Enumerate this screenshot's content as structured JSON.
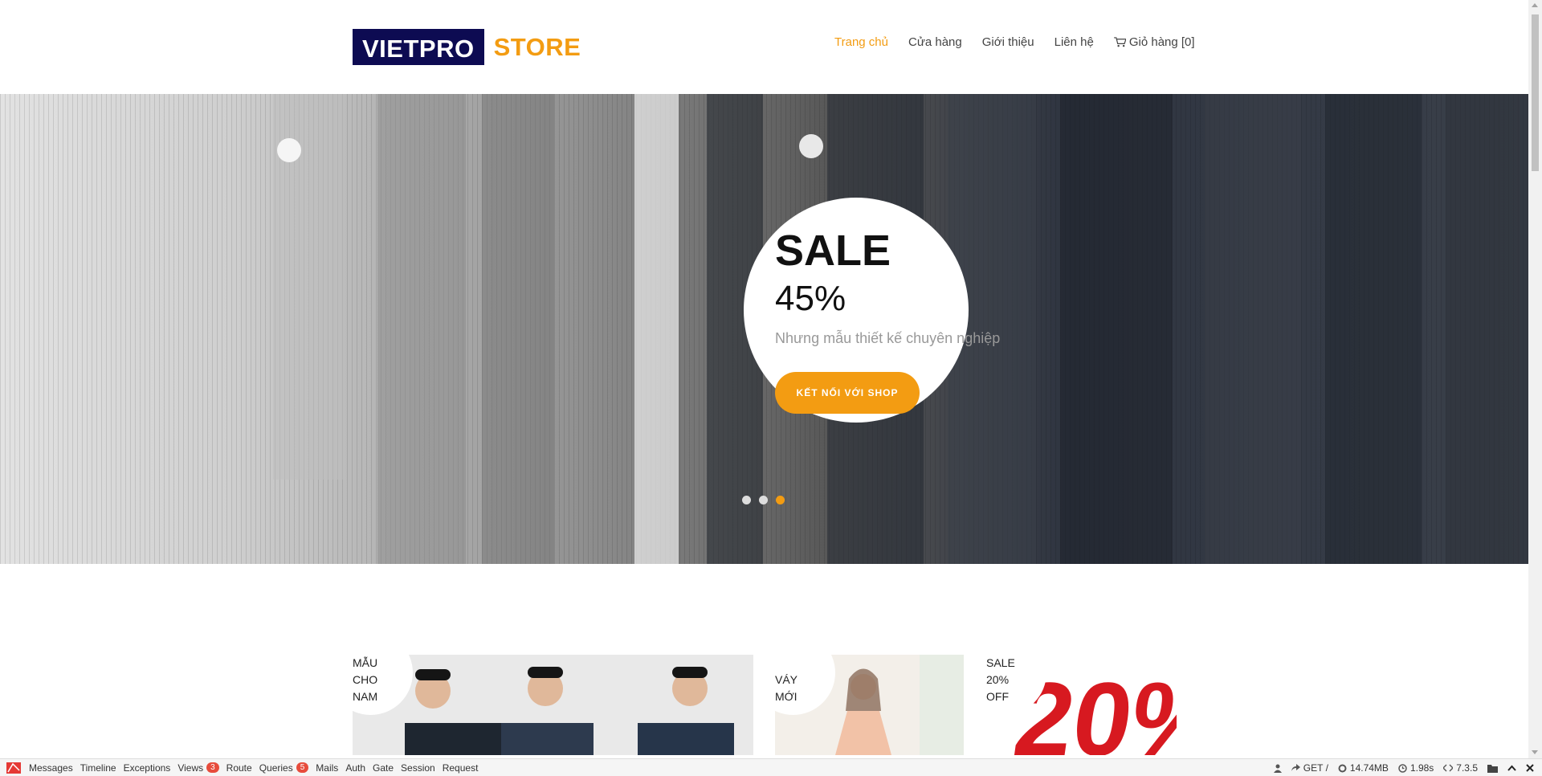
{
  "logo": {
    "part1": "VIETPRO",
    "part2": "STORE"
  },
  "nav": {
    "items": [
      {
        "label": "Trang chủ",
        "active": true
      },
      {
        "label": "Cửa hàng"
      },
      {
        "label": "Giới thiệu"
      },
      {
        "label": "Liên hệ"
      }
    ],
    "cart_label": "Giỏ hàng [0]"
  },
  "hero": {
    "title": "SALE",
    "percent": "45%",
    "subtitle": "Nhưng mẫu thiết kế chuyên nghiệp",
    "button": "KẾT NỐI VỚI SHOP",
    "active_slide": 3,
    "slide_count": 3
  },
  "categories": [
    {
      "label": "MẪU\nCHO\nNAM"
    },
    {
      "label": "VÁY\nMỚI"
    },
    {
      "label": "SALE\n20%\nOFF"
    }
  ],
  "sale_banner_text": "20%",
  "debugbar": {
    "tabs": [
      {
        "label": "Messages"
      },
      {
        "label": "Timeline"
      },
      {
        "label": "Exceptions"
      },
      {
        "label": "Views",
        "badge": "3"
      },
      {
        "label": "Route"
      },
      {
        "label": "Queries",
        "badge": "5"
      },
      {
        "label": "Mails"
      },
      {
        "label": "Auth"
      },
      {
        "label": "Gate"
      },
      {
        "label": "Session"
      },
      {
        "label": "Request"
      }
    ],
    "method": "GET /",
    "memory": "14.74MB",
    "time": "1.98s",
    "php_version": "7.3.5"
  },
  "colors": {
    "accent": "#f39c12",
    "logo_bg": "#0d0b52",
    "badge": "#e74c3c"
  }
}
